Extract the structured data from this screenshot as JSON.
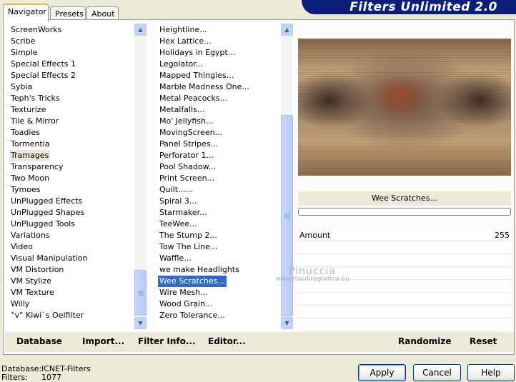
{
  "banner": {
    "title": "Filters Unlimited 2.0"
  },
  "tabs": [
    {
      "label": "Navigator",
      "active": true
    },
    {
      "label": "Presets",
      "active": false
    },
    {
      "label": "About",
      "active": false
    }
  ],
  "categories": {
    "items": [
      "ScreenWorks",
      "Scribe",
      "Simple",
      "Special Effects 1",
      "Special Effects 2",
      "Sybia",
      "Teph's Tricks",
      "Texturize",
      "Tile & Mirror",
      "Toadies",
      "Tormentia",
      "Tramages",
      "Transparency",
      "Two Moon",
      "Tymoes",
      "UnPlugged Effects",
      "UnPlugged Shapes",
      "UnPlugged Tools",
      "Variations",
      "Video",
      "Visual Manipulation",
      "VM Distortion",
      "VM Stylize",
      "VM Texture",
      "Willy",
      "°v° Kiwi`s Oelfilter"
    ],
    "highlighted": "Tramages"
  },
  "filters": {
    "items": [
      "Heightline...",
      "Hex Lattice...",
      "Holidays in Egypt...",
      "Legolator...",
      "Mapped Thingies...",
      "Marble Madness One...",
      "Metal Peacocks...",
      "Metalfalls...",
      "Mo' Jellyfish...",
      "MovingScreen...",
      "Panel Stripes...",
      "Perforator 1...",
      "Pool Shadow...",
      "Print Screen...",
      "Quilt......",
      "Spiral 3...",
      "Starmaker...",
      "TeeWee...",
      "The Stump 2...",
      "Tow The Line...",
      "Waffle...",
      "we make Headlights",
      "Wee Scratches...",
      "Wire Mesh...",
      "Wood Grain...",
      "Zero Tolerance..."
    ],
    "selected": "Wee Scratches..."
  },
  "preview": {
    "filter_name": "Wee Scratches..."
  },
  "params": [
    {
      "label": "Amount",
      "value": "255"
    }
  ],
  "watermark": {
    "line1": "Pinuccia",
    "line2": "www.maidiregrafica.eu"
  },
  "toolbar": {
    "database": "Database",
    "import": "Import...",
    "filter_info": "Filter Info...",
    "editor": "Editor...",
    "randomize": "Randomize",
    "reset": "Reset"
  },
  "status": {
    "database_label": "Database:",
    "database_value": "ICNET-Filters",
    "filters_label": "Filters:",
    "filters_value": "1077"
  },
  "buttons": {
    "apply": "Apply",
    "cancel": "Cancel",
    "help": "Help"
  },
  "colors": {
    "banner": "#0a1e7a",
    "selection": "#316ac5",
    "face": "#ece9d8"
  }
}
